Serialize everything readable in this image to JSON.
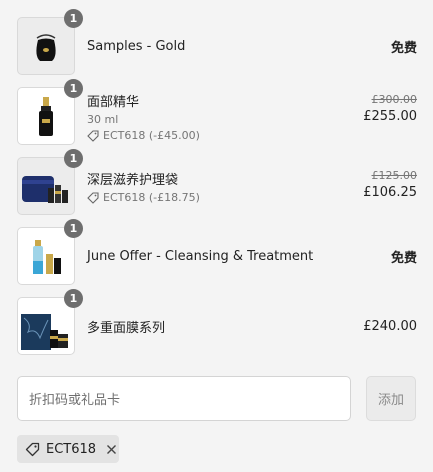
{
  "items": [
    {
      "name": "Samples - Gold",
      "quantity": "1",
      "price_free": "免费",
      "icon": "pouch-thumbnail"
    },
    {
      "name": "面部精华",
      "variant": "30 ml",
      "discount": "ECT618 (-£45.00)",
      "price_original": "£300.00",
      "price": "£255.00",
      "quantity": "1",
      "icon": "serum-bottle-thumbnail"
    },
    {
      "name": "深层滋养护理袋",
      "discount": "ECT618 (-£18.75)",
      "price_original": "£125.00",
      "price": "£106.25",
      "quantity": "1",
      "icon": "pouch-set-thumbnail"
    },
    {
      "name": "June Offer - Cleansing & Treatment",
      "quantity": "1",
      "price_free": "免费",
      "icon": "bottle-set-thumbnail"
    },
    {
      "name": "多重面膜系列",
      "quantity": "1",
      "price": "£240.00",
      "icon": "mask-collection-thumbnail"
    }
  ],
  "discount_field": {
    "placeholder": "折扣码或礼品卡",
    "apply_label": "添加"
  },
  "applied_code": {
    "label": "ECT618",
    "icon": "tag-icon",
    "remove_icon": "close-icon"
  }
}
